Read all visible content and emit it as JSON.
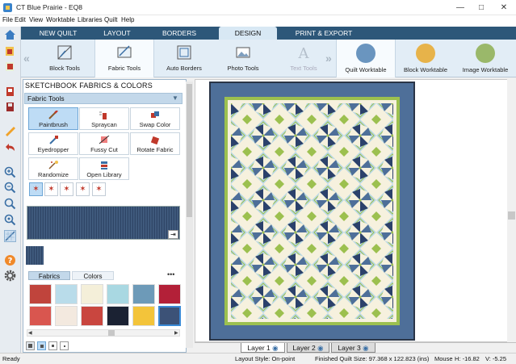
{
  "window": {
    "title": "CT Blue Prairie - EQ8",
    "controls": [
      "minimize-icon",
      "maximize-icon",
      "close-icon"
    ]
  },
  "menu": [
    "File",
    "Edit",
    "View",
    "Worktable",
    "Libraries",
    "Quilt",
    "Help"
  ],
  "main_tabs": [
    {
      "label": "NEW QUILT",
      "active": false
    },
    {
      "label": "LAYOUT",
      "active": false
    },
    {
      "label": "BORDERS",
      "active": false
    },
    {
      "label": "DESIGN",
      "active": true
    },
    {
      "label": "PRINT & EXPORT",
      "active": false
    }
  ],
  "ribbon": {
    "tools": [
      {
        "label": "Block Tools",
        "state": "normal"
      },
      {
        "label": "Fabric Tools",
        "state": "selected"
      },
      {
        "label": "Auto Borders",
        "state": "normal"
      },
      {
        "label": "Photo Tools",
        "state": "normal"
      },
      {
        "label": "Text Tools",
        "state": "disabled"
      }
    ],
    "worktables": [
      {
        "label": "Quilt Worktable",
        "state": "selected"
      },
      {
        "label": "Block Worktable",
        "state": "normal"
      },
      {
        "label": "Image Worktable",
        "state": "normal"
      }
    ]
  },
  "sidebar_icons": [
    "home-icon",
    "open-quilt-icon",
    "add-to-sketchbook-icon",
    "print-icon",
    "save-icon",
    "ruler-icon",
    "undo-icon",
    "zoom-in-icon",
    "zoom-out-icon",
    "zoom-to-fit-icon",
    "refresh-view-icon",
    "graph-paper-icon",
    "help-icon",
    "settings-icon"
  ],
  "sketchbook": {
    "title": "SKETCHBOOK FABRICS & COLORS",
    "section": "Fabric Tools",
    "tools": [
      {
        "label": "Paintbrush",
        "selected": true
      },
      {
        "label": "Spraycan",
        "selected": false
      },
      {
        "label": "Swap Color",
        "selected": false
      },
      {
        "label": "Eyedropper",
        "selected": false
      },
      {
        "label": "Fussy Cut",
        "selected": false
      },
      {
        "label": "Rotate Fabric",
        "selected": false
      },
      {
        "label": "Randomize",
        "selected": false
      },
      {
        "label": "Open Library",
        "selected": false
      }
    ],
    "subtabs": [
      "Fabrics",
      "Colors"
    ],
    "more": "•••"
  },
  "colors": {
    "tab_bar": "#2d5779",
    "quilt_navy": "#2b416b",
    "quilt_blue": "#4e6f99",
    "quilt_green": "#9cc04f",
    "quilt_cream": "#f6f1de",
    "quilt_light": "#b9d8e6"
  },
  "layers": [
    {
      "label": "Layer 1",
      "active": true
    },
    {
      "label": "Layer 2",
      "active": false
    },
    {
      "label": "Layer 3",
      "active": false
    }
  ],
  "status": {
    "state": "Ready",
    "layout_style": "Layout Style: On-point",
    "finished_size": "Finished Quilt Size: 97.368 x 122.823 (ins)",
    "mouse_label": "Mouse",
    "h_value": "H:  -16.82",
    "v_value": "V:  -5.25"
  }
}
